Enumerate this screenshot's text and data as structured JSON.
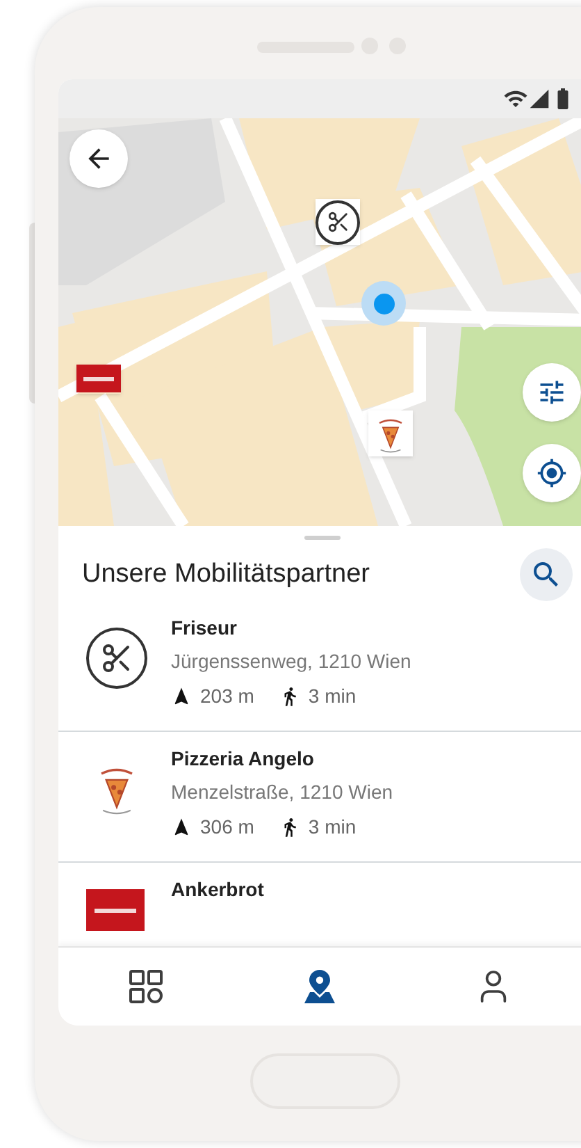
{
  "sheet": {
    "title": "Unsere Mobilitätspartner"
  },
  "partners": [
    {
      "kind": "barber",
      "name": "Friseur",
      "address": "Jürgenssenweg, 1210 Wien",
      "distance": "203 m",
      "walk_time": "3 min"
    },
    {
      "kind": "pizzeria",
      "name": "Pizzeria Angelo",
      "address": "Menzelstraße, 1210 Wien",
      "distance": "306 m",
      "walk_time": "3 min"
    },
    {
      "kind": "bakery",
      "name": "Ankerbrot"
    }
  ],
  "nav": [
    {
      "kind": "dashboard",
      "selected": false
    },
    {
      "kind": "map",
      "selected": true
    },
    {
      "kind": "profile",
      "selected": false
    }
  ]
}
